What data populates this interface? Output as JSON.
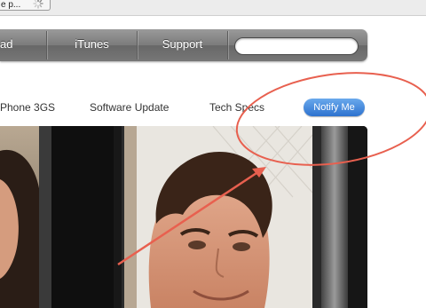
{
  "browser": {
    "tab_fragment": "e p..."
  },
  "navbar": {
    "items": [
      {
        "label": "ad"
      },
      {
        "label": "iTunes"
      },
      {
        "label": "Support"
      }
    ],
    "search_value": ""
  },
  "subnav": {
    "items": [
      {
        "label": "Phone 3GS"
      },
      {
        "label": "Software Update"
      },
      {
        "label": "Tech Specs"
      }
    ],
    "notify_label": "Notify Me"
  },
  "annotations": {
    "color": "#e8604f"
  },
  "colors": {
    "accent_blue": "#2d72cf"
  }
}
